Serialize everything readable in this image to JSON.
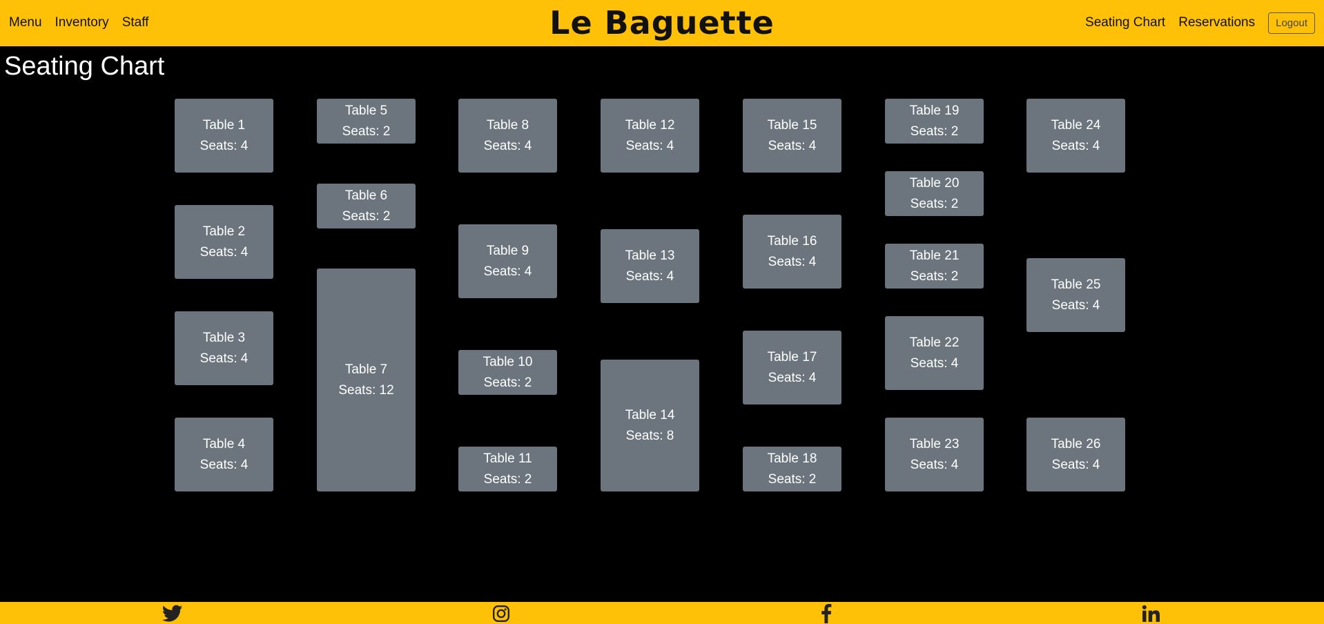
{
  "nav": {
    "left": [
      "Menu",
      "Inventory",
      "Staff"
    ],
    "brand": "Le Baguette",
    "right": [
      "Seating Chart",
      "Reservations"
    ],
    "logout": "Logout"
  },
  "page_title": "Seating Chart",
  "tables": [
    {
      "name": "Table 1",
      "seats": "Seats: 4"
    },
    {
      "name": "Table 2",
      "seats": "Seats: 4"
    },
    {
      "name": "Table 3",
      "seats": "Seats: 4"
    },
    {
      "name": "Table 4",
      "seats": "Seats: 4"
    },
    {
      "name": "Table 5",
      "seats": "Seats: 2"
    },
    {
      "name": "Table 6",
      "seats": "Seats: 2"
    },
    {
      "name": "Table 7",
      "seats": "Seats: 12"
    },
    {
      "name": "Table 8",
      "seats": "Seats: 4"
    },
    {
      "name": "Table 9",
      "seats": "Seats: 4"
    },
    {
      "name": "Table 10",
      "seats": "Seats: 2"
    },
    {
      "name": "Table 11",
      "seats": "Seats: 2"
    },
    {
      "name": "Table 12",
      "seats": "Seats: 4"
    },
    {
      "name": "Table 13",
      "seats": "Seats: 4"
    },
    {
      "name": "Table 14",
      "seats": "Seats: 8"
    },
    {
      "name": "Table 15",
      "seats": "Seats: 4"
    },
    {
      "name": "Table 16",
      "seats": "Seats: 4"
    },
    {
      "name": "Table 17",
      "seats": "Seats: 4"
    },
    {
      "name": "Table 18",
      "seats": "Seats: 2"
    },
    {
      "name": "Table 19",
      "seats": "Seats: 2"
    },
    {
      "name": "Table 20",
      "seats": "Seats: 2"
    },
    {
      "name": "Table 21",
      "seats": "Seats: 2"
    },
    {
      "name": "Table 22",
      "seats": "Seats: 4"
    },
    {
      "name": "Table 23",
      "seats": "Seats: 4"
    },
    {
      "name": "Table 24",
      "seats": "Seats: 4"
    },
    {
      "name": "Table 25",
      "seats": "Seats: 4"
    },
    {
      "name": "Table 26",
      "seats": "Seats: 4"
    }
  ],
  "footer": {
    "icons": [
      "twitter-icon",
      "instagram-icon",
      "facebook-icon",
      "linkedin-icon"
    ]
  },
  "colors": {
    "accent": "#ffc107",
    "background": "#000000",
    "table": "#6c757d"
  }
}
